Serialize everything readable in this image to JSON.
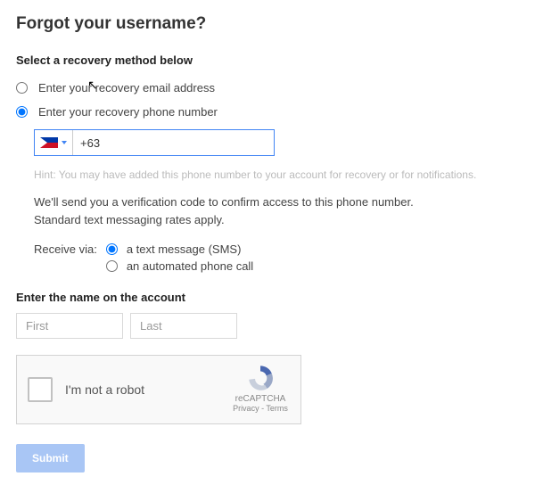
{
  "title": "Forgot your username?",
  "recovery": {
    "heading": "Select a recovery method below",
    "option_email": "Enter your recovery email address",
    "option_phone": "Enter your recovery phone number",
    "selected": "phone"
  },
  "phone": {
    "country_code_value": "+63",
    "hint": "Hint: You may have added this phone number to your account for recovery or for notifications.",
    "info_line1": "We'll send you a verification code to confirm access to this phone number.",
    "info_line2": "Standard text messaging rates apply."
  },
  "receive": {
    "label": "Receive via:",
    "option_sms": "a text message (SMS)",
    "option_call": "an automated phone call",
    "selected": "sms"
  },
  "name": {
    "heading": "Enter the name on the account",
    "first_placeholder": "First",
    "last_placeholder": "Last"
  },
  "recaptcha": {
    "label": "I'm not a robot",
    "brand": "reCAPTCHA",
    "privacy": "Privacy",
    "terms": "Terms"
  },
  "submit_label": "Submit"
}
